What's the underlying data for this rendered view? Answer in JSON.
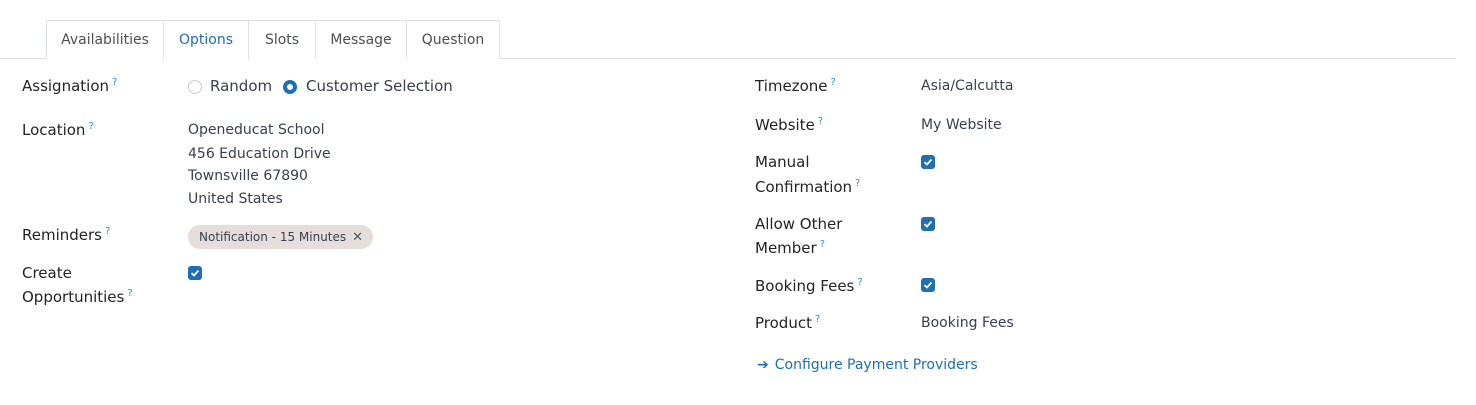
{
  "tabs": [
    {
      "label": "Availabilities"
    },
    {
      "label": "Options"
    },
    {
      "label": "Slots"
    },
    {
      "label": "Message"
    },
    {
      "label": "Question"
    }
  ],
  "active_tab": "Options",
  "help_mark": "?",
  "left": {
    "assignation": {
      "label": "Assignation",
      "options": [
        "Random",
        "Customer Selection"
      ],
      "selected": "Customer Selection"
    },
    "location": {
      "label": "Location",
      "lines": [
        "Openeducat School",
        "456 Education Drive",
        "Townsville 67890",
        "United States"
      ]
    },
    "reminders": {
      "label": "Reminders",
      "tag": "Notification - 15 Minutes",
      "remove_glyph": "✕"
    },
    "create_opportunities": {
      "label_line1": "Create",
      "label_line2": "Opportunities",
      "checked": true
    }
  },
  "right": {
    "timezone": {
      "label": "Timezone",
      "value": "Asia/Calcutta"
    },
    "website": {
      "label": "Website",
      "value": "My Website"
    },
    "manual_confirmation": {
      "label_line1": "Manual",
      "label_line2": "Confirmation",
      "checked": true
    },
    "allow_other_member": {
      "label_line1": "Allow Other",
      "label_line2": "Member",
      "checked": true
    },
    "booking_fees": {
      "label": "Booking Fees",
      "checked": true
    },
    "product": {
      "label": "Product",
      "value": "Booking Fees"
    },
    "configure_link": {
      "arrow": "➔",
      "label": "Configure Payment Providers"
    }
  },
  "colors": {
    "accent": "#1f6fb2",
    "help": "#2c8fc7",
    "tag_bg": "#e6dedb"
  }
}
